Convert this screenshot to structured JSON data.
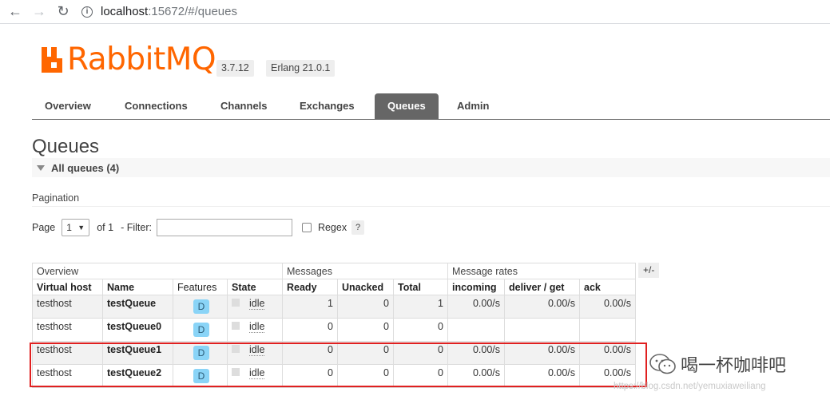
{
  "browser": {
    "url_host": "localhost",
    "url_rest": ":15672/#/queues"
  },
  "header": {
    "logo_text": "RabbitMQ",
    "logo_tm": "TM",
    "version": "3.7.12",
    "erlang": "Erlang 21.0.1"
  },
  "tabs": [
    {
      "label": "Overview",
      "active": false
    },
    {
      "label": "Connections",
      "active": false
    },
    {
      "label": "Channels",
      "active": false
    },
    {
      "label": "Exchanges",
      "active": false
    },
    {
      "label": "Queues",
      "active": true
    },
    {
      "label": "Admin",
      "active": false
    }
  ],
  "page": {
    "title": "Queues",
    "section": "All queues (4)"
  },
  "pagination": {
    "label": "Pagination",
    "page_label": "Page",
    "page_value": "1",
    "of_label": "of 1",
    "filter_label": "- Filter:",
    "filter_value": "",
    "regex_label": "Regex",
    "help": "?"
  },
  "table": {
    "groups": [
      "Overview",
      "Messages",
      "Message rates"
    ],
    "columns": [
      "Virtual host",
      "Name",
      "Features",
      "State",
      "Ready",
      "Unacked",
      "Total",
      "incoming",
      "deliver / get",
      "ack"
    ],
    "toggle": "+/-",
    "rows": [
      {
        "vhost": "testhost",
        "name": "testQueue",
        "feature": "D",
        "state": "idle",
        "ready": "1",
        "unacked": "0",
        "total": "1",
        "incoming": "0.00/s",
        "deliver": "0.00/s",
        "ack": "0.00/s"
      },
      {
        "vhost": "testhost",
        "name": "testQueue0",
        "feature": "D",
        "state": "idle",
        "ready": "0",
        "unacked": "0",
        "total": "0",
        "incoming": "",
        "deliver": "",
        "ack": ""
      },
      {
        "vhost": "testhost",
        "name": "testQueue1",
        "feature": "D",
        "state": "idle",
        "ready": "0",
        "unacked": "0",
        "total": "0",
        "incoming": "0.00/s",
        "deliver": "0.00/s",
        "ack": "0.00/s"
      },
      {
        "vhost": "testhost",
        "name": "testQueue2",
        "feature": "D",
        "state": "idle",
        "ready": "0",
        "unacked": "0",
        "total": "0",
        "incoming": "0.00/s",
        "deliver": "0.00/s",
        "ack": "0.00/s"
      }
    ]
  },
  "watermark": {
    "text": "喝一杯咖啡吧",
    "url": "https://blog.csdn.net/yemuxiaweiliang"
  },
  "colors": {
    "brand": "#ff6600",
    "tab_active": "#666666",
    "feature_badge": "#8ad4f7",
    "highlight_box": "#e02020"
  }
}
